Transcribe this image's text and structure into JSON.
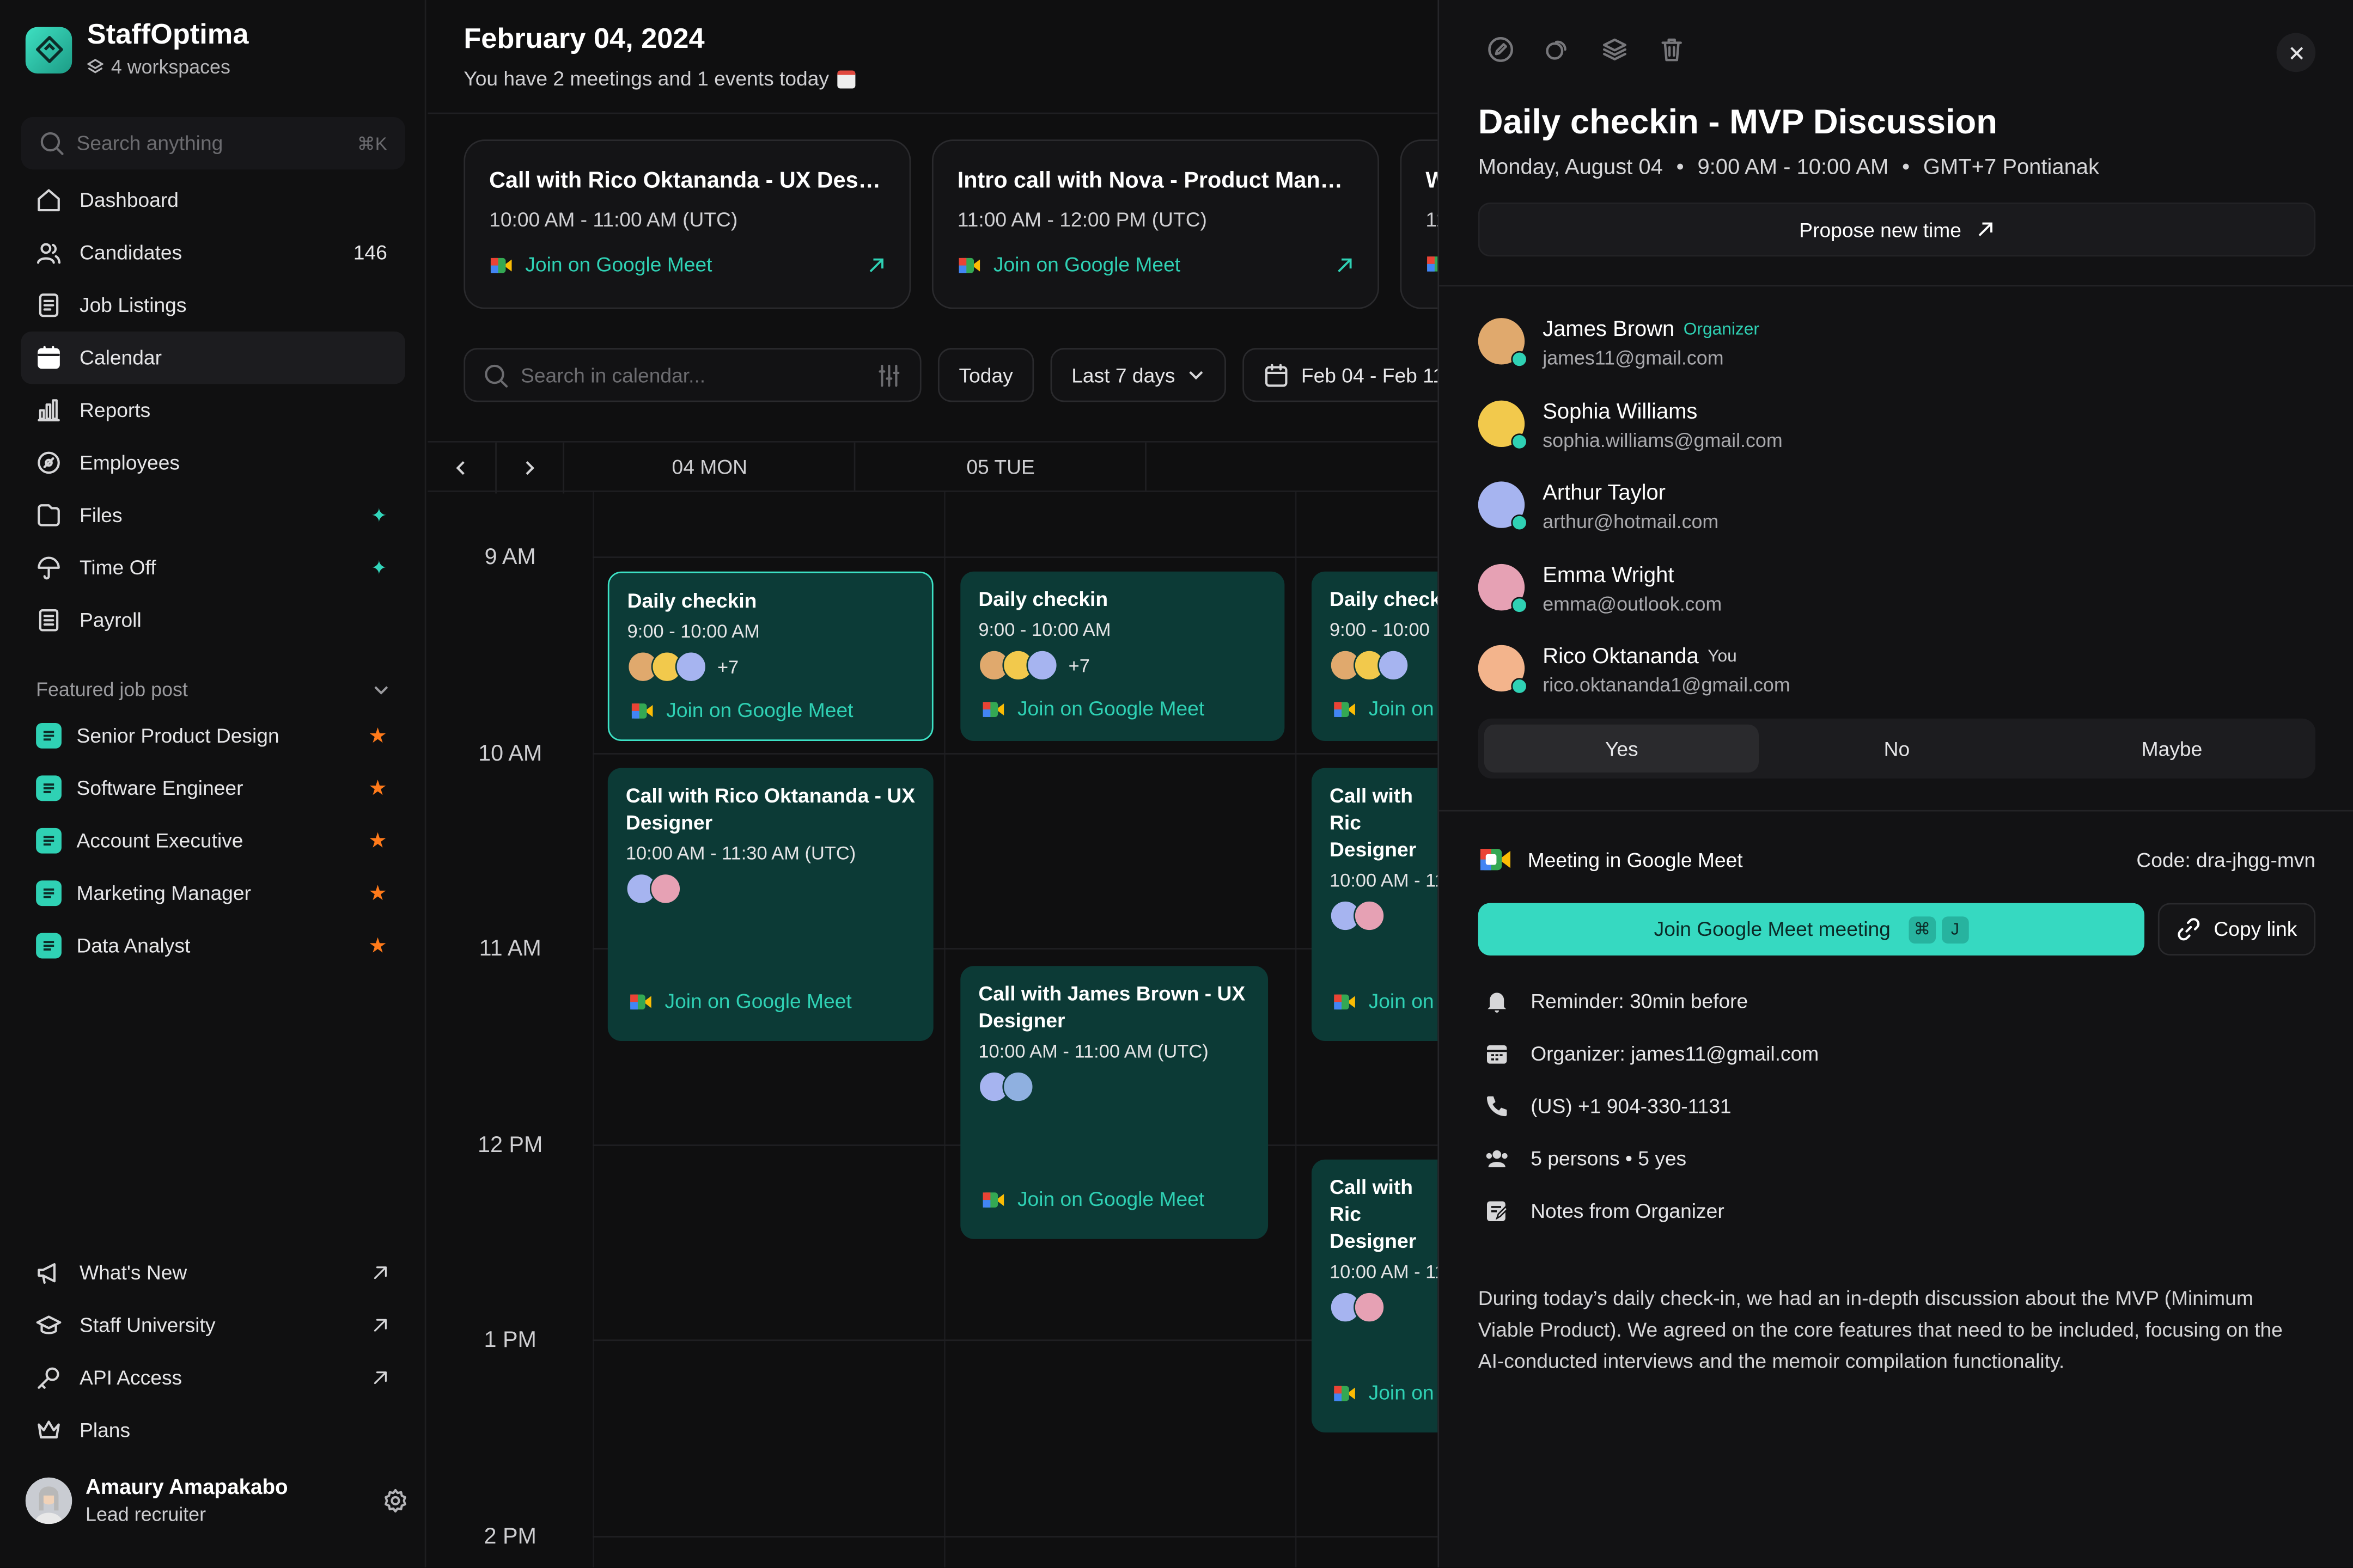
{
  "sidebar": {
    "brand": "StaffOptima",
    "workspaces": "4 workspaces",
    "search_placeholder": "Search anything",
    "search_shortcut": "⌘K",
    "nav": [
      {
        "label": "Dashboard",
        "icon": "home-icon"
      },
      {
        "label": "Candidates",
        "icon": "users-icon",
        "count": "146"
      },
      {
        "label": "Job Listings",
        "icon": "list-icon"
      },
      {
        "label": "Calendar",
        "icon": "calendar-icon",
        "active": true
      },
      {
        "label": "Reports",
        "icon": "chart-icon"
      },
      {
        "label": "Employees",
        "icon": "badge-icon"
      },
      {
        "label": "Files",
        "icon": "file-icon",
        "badge": "sparkle"
      },
      {
        "label": "Time Off",
        "icon": "umbrella-icon",
        "badge": "sparkle"
      },
      {
        "label": "Payroll",
        "icon": "receipt-icon"
      }
    ],
    "featured_title": "Featured job post",
    "featured": [
      "Senior Product Design",
      "Software Engineer",
      "Account Executive",
      "Marketing Manager",
      "Data Analyst"
    ],
    "bottom_nav": [
      {
        "label": "What's New",
        "icon": "megaphone-icon"
      },
      {
        "label": "Staff University",
        "icon": "graduation-icon"
      },
      {
        "label": "API Access",
        "icon": "key-icon"
      },
      {
        "label": "Plans",
        "icon": "crown-icon"
      }
    ],
    "user": {
      "name": "Amaury Amapakabo",
      "role": "Lead recruiter"
    }
  },
  "main": {
    "date_title": "February 04, 2024",
    "date_sub": "You have 2 meetings and 1 events today",
    "cards": [
      {
        "title": "Call with Rico Oktananda - UX Designer",
        "time": "10:00 AM - 11:00 AM (UTC)",
        "link": "Join on Google Meet"
      },
      {
        "title": "Intro call with Nova - Product Manager",
        "time": "11:00 AM - 12:00 PM (UTC)",
        "link": "Join on Google Meet"
      },
      {
        "title": "W",
        "time": "11",
        "link": ""
      }
    ],
    "toolbar": {
      "search_placeholder": "Search in calendar...",
      "today": "Today",
      "range": "Last 7 days",
      "dates": "Feb 04 - Feb 11 2"
    },
    "days": [
      "04 MON",
      "05 TUE",
      ""
    ],
    "hours": [
      "9 AM",
      "10 AM",
      "11 AM",
      "12 PM",
      "1 PM",
      "2 PM"
    ],
    "events": [
      {
        "title": "Daily checkin",
        "time": "9:00 - 10:00 AM",
        "more": "+7",
        "link": "Join on Google Meet"
      },
      {
        "title": "Daily checkin",
        "time": "9:00 - 10:00 AM",
        "more": "+7",
        "link": "Join on Google Meet"
      },
      {
        "title": "Daily checki",
        "time": "9:00 - 10:00",
        "link": "Join on"
      },
      {
        "title": "Call with Rico Oktananda - UX Designer",
        "time": "10:00 AM - 11:30 AM (UTC)",
        "link": "Join on Google Meet"
      },
      {
        "title": "Call with Ric Designer",
        "time": "10:00 AM - 11",
        "link": "Join on"
      },
      {
        "title": "Call with James Brown - UX Designer",
        "time": "10:00 AM - 11:00 AM (UTC)",
        "link": "Join on Google Meet"
      },
      {
        "title": "Call with Ric Designer",
        "time": "10:00 AM - 11",
        "link": "Join on"
      }
    ]
  },
  "panel": {
    "title": "Daily checkin - MVP Discussion",
    "date": "Monday, August 04",
    "time": "9:00 AM - 10:00 AM",
    "tz": "GMT+7 Pontianak",
    "propose": "Propose new time",
    "attendees": [
      {
        "name": "James Brown",
        "tag": "Organizer",
        "email": "james11@gmail.com",
        "color": "#e0a96d"
      },
      {
        "name": "Sophia Williams",
        "tag": "",
        "email": "sophia.williams@gmail.com",
        "color": "#f2c94c"
      },
      {
        "name": "Arthur Taylor",
        "tag": "",
        "email": "arthur@hotmail.com",
        "color": "#a6b4f0"
      },
      {
        "name": "Emma Wright",
        "tag": "",
        "email": "emma@outlook.com",
        "color": "#e6a1b4"
      },
      {
        "name": "Rico Oktananda",
        "tag": "You",
        "email": "rico.oktananda1@gmail.com",
        "color": "#f3b48c"
      }
    ],
    "rsvp": [
      "Yes",
      "No",
      "Maybe"
    ],
    "meet_label": "Meeting in Google Meet",
    "meet_code": "Code: dra-jhgg-mvn",
    "join_label": "Join Google Meet meeting",
    "join_keys": [
      "⌘",
      "J"
    ],
    "copy_label": "Copy link",
    "details": [
      {
        "icon": "bell-icon",
        "text": "Reminder: 30min before"
      },
      {
        "icon": "calendar-icon",
        "text": "Organizer: james11@gmail.com"
      },
      {
        "icon": "phone-icon",
        "text": "(US) +1 904-330-1131"
      },
      {
        "icon": "people-icon",
        "text": "5 persons  •  5 yes"
      },
      {
        "icon": "notes-icon",
        "text": "Notes from Organizer"
      }
    ],
    "notes": "During today’s daily check-in, we had an in-depth discussion about the MVP (Minimum Viable Product). We agreed on the core features that need to be included, focusing on the AI-conducted interviews and the memoir compilation functionality."
  },
  "colors": {
    "accent": "#2fd1b4",
    "event_bg": "#0c3a36",
    "star": "#ff7a1a"
  }
}
